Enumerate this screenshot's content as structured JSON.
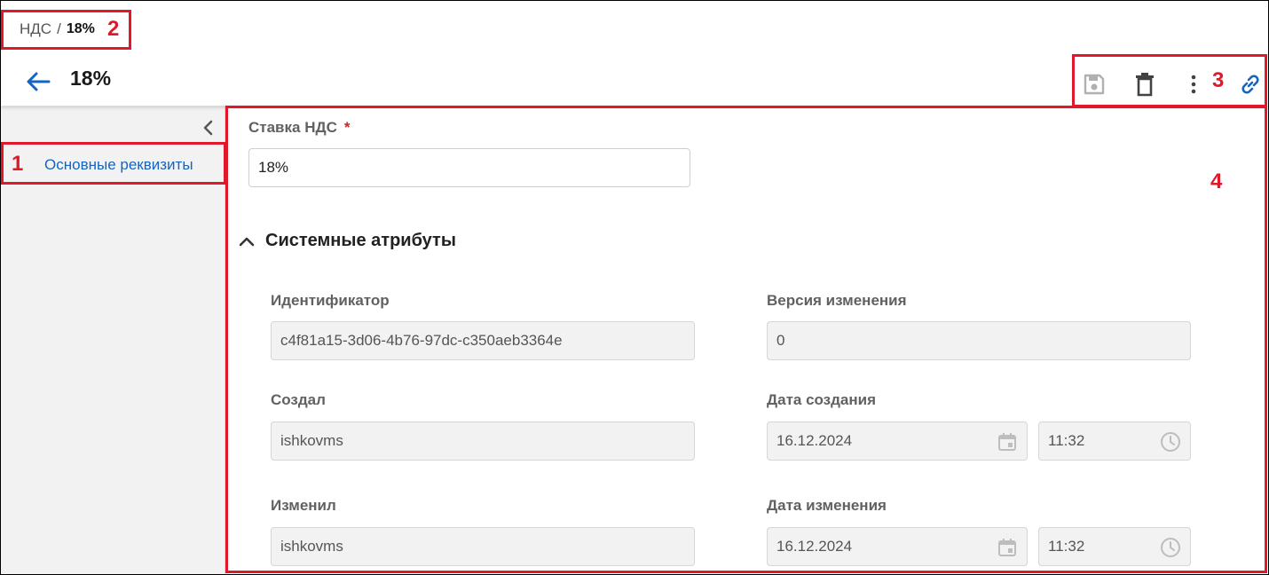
{
  "breadcrumb": {
    "parent": "НДС",
    "separator": "/",
    "current": "18%"
  },
  "header": {
    "title": "18%"
  },
  "sidebar": {
    "items": [
      {
        "label": "Основные реквизиты",
        "active": true
      }
    ]
  },
  "form": {
    "vat_rate_label": "Ставка НДС",
    "required_mark": "*",
    "vat_rate_value": "18%"
  },
  "system_attributes": {
    "title": "Системные атрибуты",
    "id_label": "Идентификатор",
    "id_value": "c4f81a15-3d06-4b76-97dc-c350aeb3364e",
    "version_label": "Версия изменения",
    "version_value": "0",
    "created_by_label": "Создал",
    "created_by_value": "ishkovms",
    "created_date_label": "Дата создания",
    "created_date_value": "16.12.2024",
    "created_time_value": "11:32",
    "modified_by_label": "Изменил",
    "modified_by_value": "ishkovms",
    "modified_date_label": "Дата изменения",
    "modified_date_value": "16.12.2024",
    "modified_time_value": "11:32"
  },
  "annotations": {
    "a1": "1",
    "a2": "2",
    "a3": "3",
    "a4": "4"
  },
  "colors": {
    "accent": "#1565c0",
    "annotation": "#e0182a",
    "required": "#c62828"
  },
  "icons": [
    "arrow-left-icon",
    "save-icon",
    "delete-icon",
    "more-vert-icon",
    "link-icon",
    "chevron-left-icon",
    "chevron-up-icon",
    "calendar-icon",
    "clock-icon"
  ]
}
